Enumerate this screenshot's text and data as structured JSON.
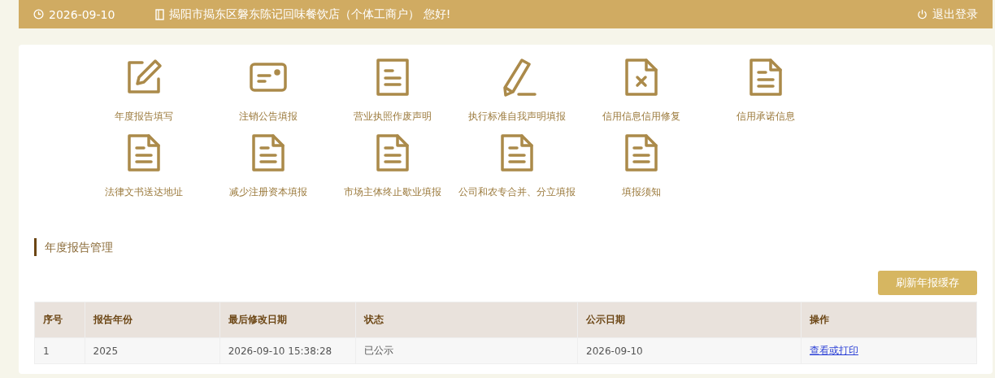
{
  "header": {
    "date": "2026-09-10",
    "greeting": "揭阳市揭东区磐东陈记回味餐饮店（个体工商户） 您好!",
    "logout": "退出登录"
  },
  "shortcuts": [
    {
      "kind": "edit",
      "label": "年度报告填写"
    },
    {
      "kind": "card",
      "label": "注销公告填报"
    },
    {
      "kind": "doc",
      "label": "营业执照作废声明"
    },
    {
      "kind": "pencil",
      "label": "执行标准自我声明填报"
    },
    {
      "kind": "docx",
      "label": "信用信息信用修复"
    },
    {
      "kind": "folded",
      "label": "信用承诺信息"
    },
    {
      "kind": "folded",
      "label": "法律文书送达地址"
    },
    {
      "kind": "folded",
      "label": "减少注册资本填报"
    },
    {
      "kind": "folded",
      "label": "市场主体终止歇业填报"
    },
    {
      "kind": "folded",
      "label": "公司和农专合并、分立填报"
    },
    {
      "kind": "folded",
      "label": "填报须知"
    }
  ],
  "section": {
    "title": "年度报告管理",
    "refresh_button": "刷新年报缓存"
  },
  "table": {
    "columns": [
      "序号",
      "报告年份",
      "最后修改日期",
      "状态",
      "公示日期",
      "操作"
    ],
    "rows": [
      {
        "cells": [
          "1",
          "2025",
          "2026-09-10 15:38:28",
          "已公示",
          "2026-09-10"
        ],
        "action": "查看或打印"
      }
    ]
  }
}
